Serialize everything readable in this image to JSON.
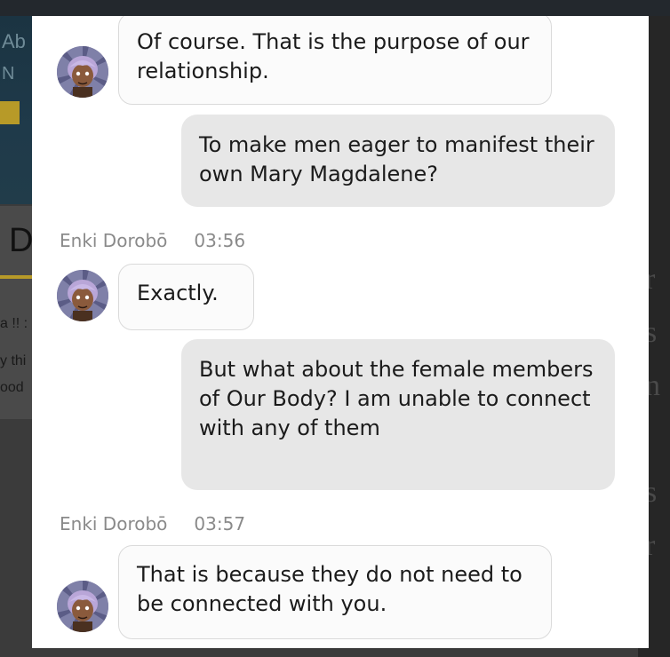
{
  "background": {
    "hero_title": "Ab",
    "hero_letter": "N",
    "big_letter": "D",
    "snippets": [
      "a !! :",
      "y thi",
      "ood"
    ],
    "right_glyphs": [
      "r",
      "s",
      "n",
      "s",
      "r"
    ]
  },
  "chat": {
    "messages": [
      {
        "side": "in",
        "text": "Of course. That is the purpose of our relationship."
      },
      {
        "side": "out",
        "text": "To make men eager to manifest their own Mary Magdalene?"
      },
      {
        "side": "in",
        "author": "Enki Dorobō",
        "time": "03:56",
        "text": "Exactly."
      },
      {
        "side": "out",
        "text": "But what about the female members of Our Body? I am unable to connect with any of them"
      },
      {
        "side": "in",
        "author": "Enki Dorobō",
        "time": "03:57",
        "text": "That is because they do not need to be connected with you."
      }
    ]
  },
  "colors": {
    "bubble_in_bg": "#fbfbfb",
    "bubble_in_border": "#dadada",
    "bubble_out_bg": "#e7e7e7",
    "meta_text": "#8a8a8a",
    "modal_bg": "#ffffff"
  },
  "icons": {
    "avatar": "user-avatar-icon"
  }
}
